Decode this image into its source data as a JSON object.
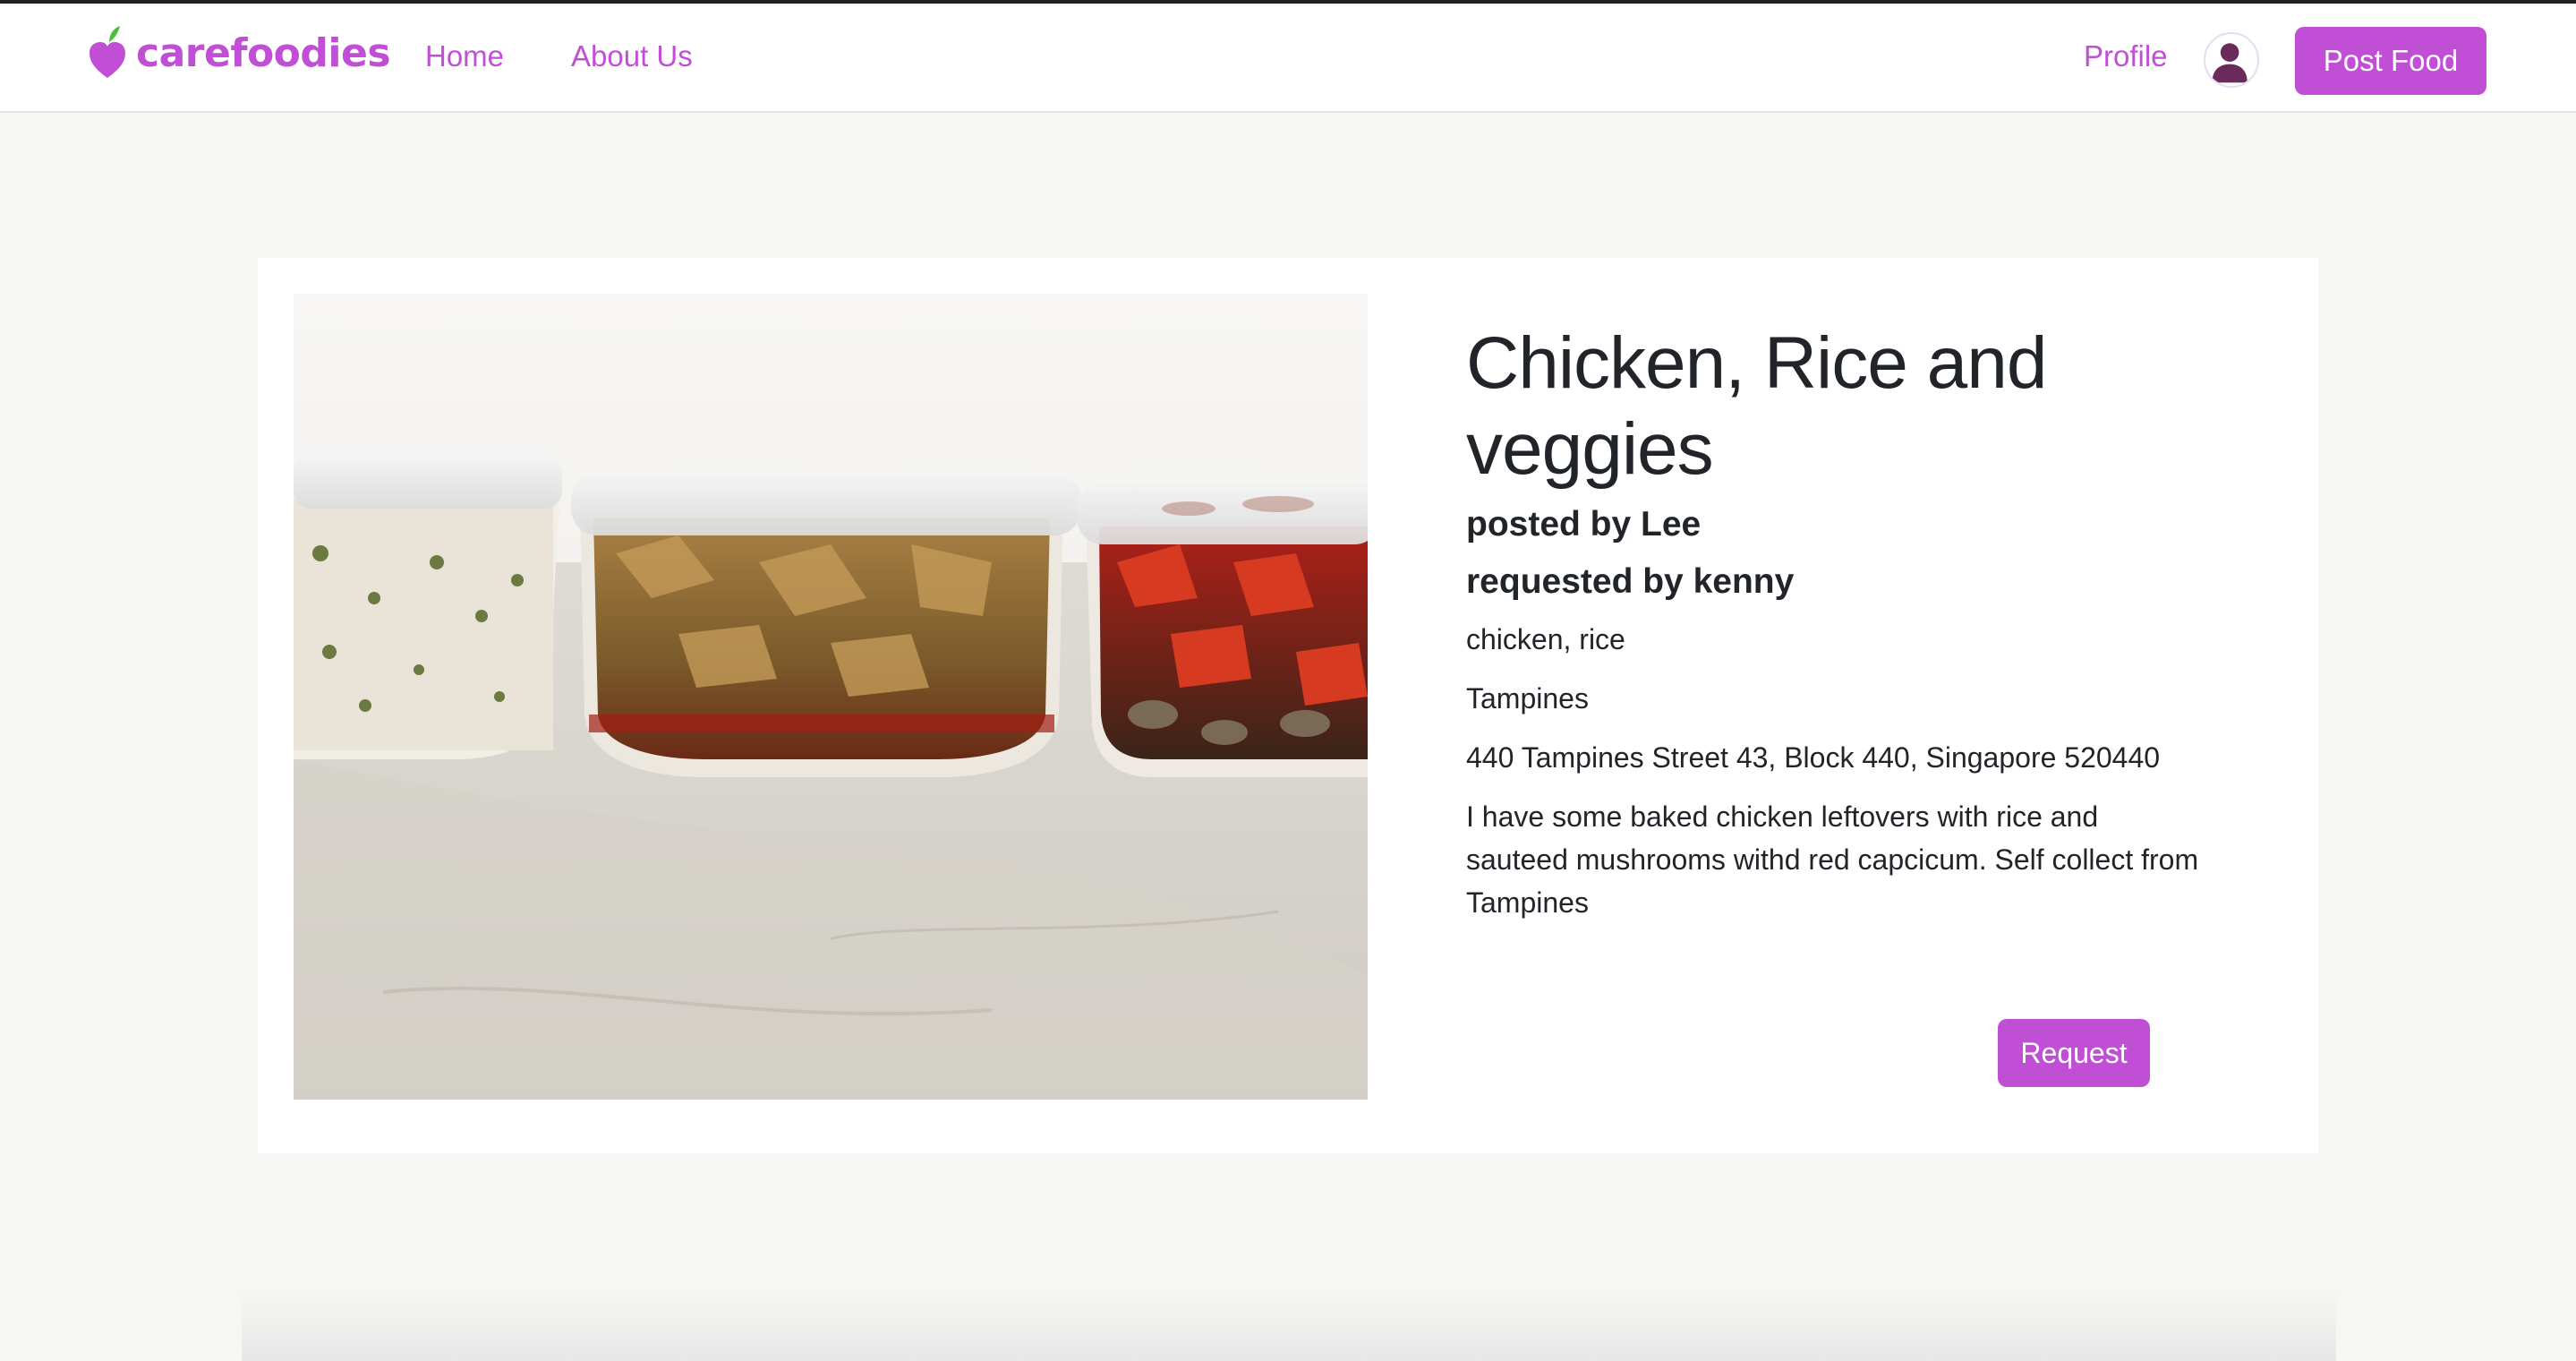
{
  "navbar": {
    "brand": "carefoodies",
    "links": [
      "Home",
      "About Us"
    ],
    "profile_label": "Profile",
    "post_button": "Post Food"
  },
  "post": {
    "title": "Chicken, Rice and veggies",
    "posted_by": "posted by Lee",
    "requested_by": "requested by kenny",
    "ingredients": "chicken, rice",
    "area": "Tampines",
    "address": "440 Tampines Street 43, Block 440, Singapore 520440",
    "description": "I have some baked chicken leftovers with rice and sauteed mushrooms withd red capcicum. Self collect from Tampines",
    "request_button": "Request"
  },
  "colors": {
    "accent": "#c04fd6",
    "leaf": "#4cbf3a",
    "page_bg": "#f6f6f4"
  },
  "icons": {
    "brand": "apple-heart-icon",
    "avatar": "user-avatar-icon"
  }
}
